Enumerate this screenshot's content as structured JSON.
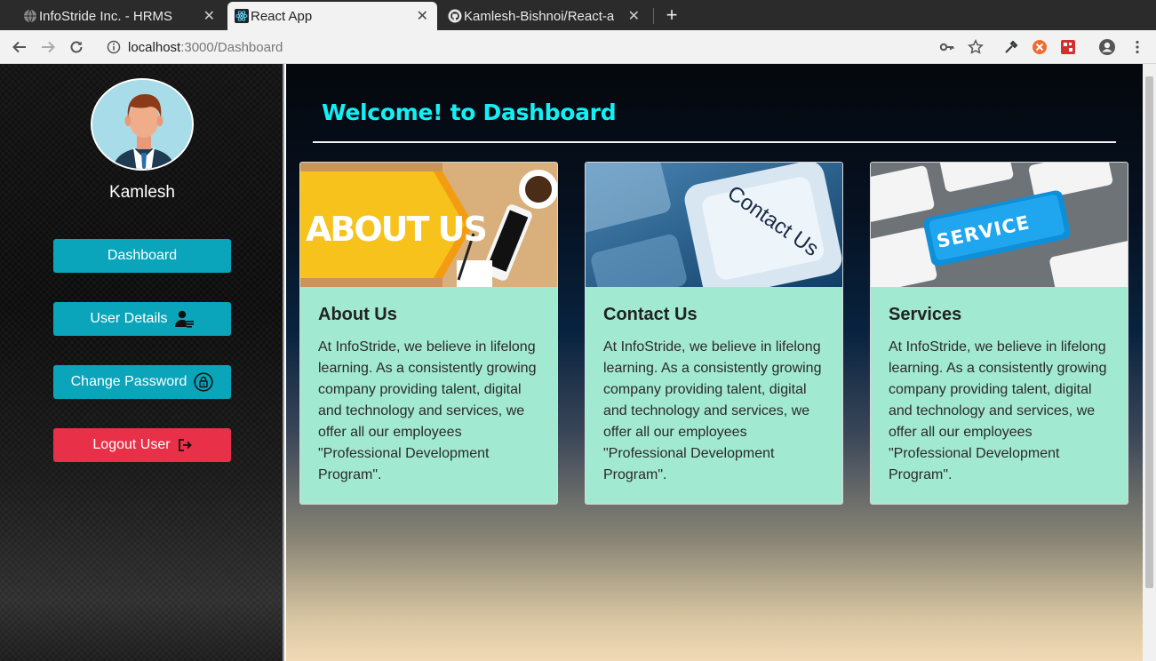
{
  "browser": {
    "tabs": [
      {
        "title": "InfoStride Inc. - HRMS",
        "favicon": "globe-icon",
        "active": false
      },
      {
        "title": "React App",
        "favicon": "react-icon",
        "active": true
      },
      {
        "title": "Kamlesh-Bishnoi/React-a",
        "favicon": "github-icon",
        "active": false
      }
    ],
    "close_glyph": "✕",
    "new_tab_glyph": "+",
    "url_host": "localhost",
    "url_path": ":3000/Dashboard"
  },
  "sidebar": {
    "username": "Kamlesh",
    "nav": [
      {
        "label": "Dashboard",
        "icon": ""
      },
      {
        "label": "User Details",
        "icon": "user-card-icon"
      },
      {
        "label": "Change Password",
        "icon": "lock-icon"
      },
      {
        "label": "Logout User",
        "icon": "logout-icon"
      }
    ]
  },
  "main": {
    "heading": "Welcome! to Dashboard",
    "cards": [
      {
        "image_text": "ABOUT US",
        "title": "About Us",
        "body": "At InfoStride, we believe in lifelong learning. As a consistently growing company providing talent, digital and technology and services, we offer all our employees \"Professional Development Program\"."
      },
      {
        "image_text": "Contact Us",
        "title": "Contact Us",
        "body": "At InfoStride, we believe in lifelong learning. As a consistently growing company providing talent, digital and technology and services, we offer all our employees \"Professional Development Program\"."
      },
      {
        "image_text": "SERVICE",
        "title": "Services",
        "body": "At InfoStride, we believe in lifelong learning. As a consistently growing company providing talent, digital and technology and services, we offer all our employees \"Professional Development Program\"."
      }
    ]
  },
  "colors": {
    "accent_teal": "#0aa5ba",
    "logout_red": "#e83049",
    "heading_cyan": "#13f0f5",
    "card_bg": "#a2e9d1"
  }
}
